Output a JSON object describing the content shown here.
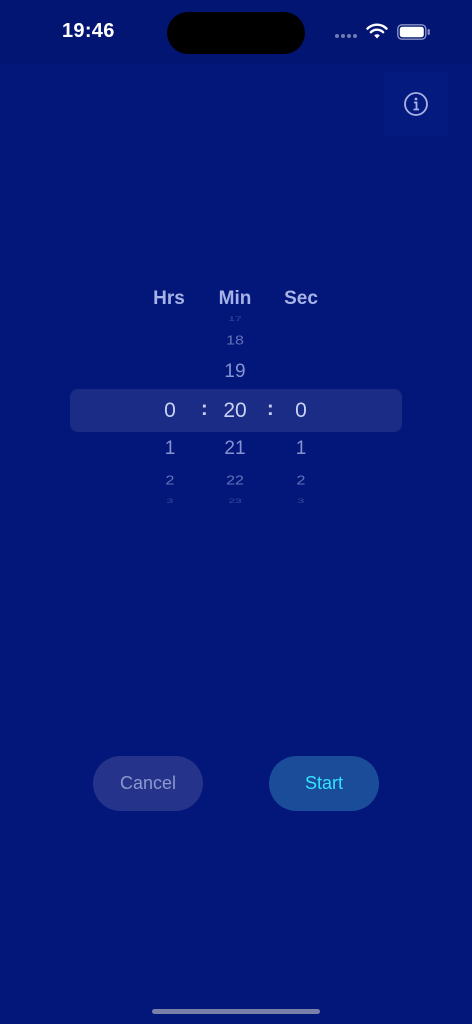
{
  "status_bar": {
    "time": "19:46",
    "icons": [
      "cellular-signal-icon",
      "wifi-icon",
      "battery-icon"
    ]
  },
  "header": {
    "info_icon": "info-circle-icon"
  },
  "picker": {
    "labels": {
      "hours": "Hrs",
      "minutes": "Min",
      "seconds": "Sec"
    },
    "separator": ":",
    "hours": {
      "selected": "0",
      "above": [],
      "below": [
        "1",
        "2",
        "3"
      ]
    },
    "minutes": {
      "selected": "20",
      "above": [
        "17",
        "18",
        "19"
      ],
      "below": [
        "21",
        "22",
        "23"
      ]
    },
    "seconds": {
      "selected": "0",
      "above": [],
      "below": [
        "1",
        "2",
        "3"
      ]
    }
  },
  "actions": {
    "cancel_label": "Cancel",
    "start_label": "Start"
  },
  "colors": {
    "background": "#03167a",
    "accent": "#33e2ff",
    "picker_label": "#a7b3e6"
  }
}
